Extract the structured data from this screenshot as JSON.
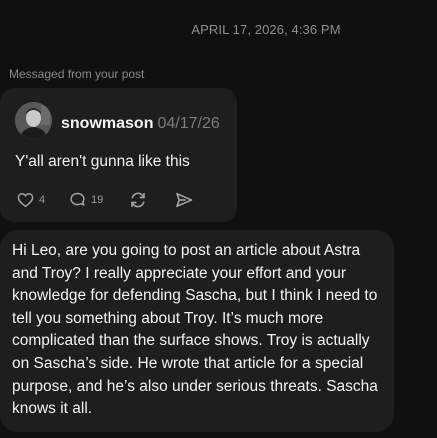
{
  "thread": {
    "timestamp": "APRIL 17, 2026, 4:36 PM"
  },
  "shared_post": {
    "context_label": "Messaged from your post",
    "author": "snowmason",
    "date": "04/17/26",
    "text": "Y'all aren't gunna like this",
    "actions": {
      "like_count": "4",
      "comment_count": "19",
      "repost_icon": "repost-icon",
      "share_icon": "send-icon"
    }
  },
  "message": {
    "text": "Hi Leo, are you going to post an article about Astra and Troy? I really appreciate your effort and your knowledge for defending Sascha, but I think I need to tell you something about Troy. It’s much more complicated than the surface shows. Troy is actually on Sascha’s side. He wrote that article for a special purpose, and he’s also under serious threats. Sascha knows it all."
  },
  "colors": {
    "background": "#101010",
    "bubble": "#1e1e1e",
    "muted_text": "#8e8e8e",
    "primary_text": "#f3f3f3"
  }
}
